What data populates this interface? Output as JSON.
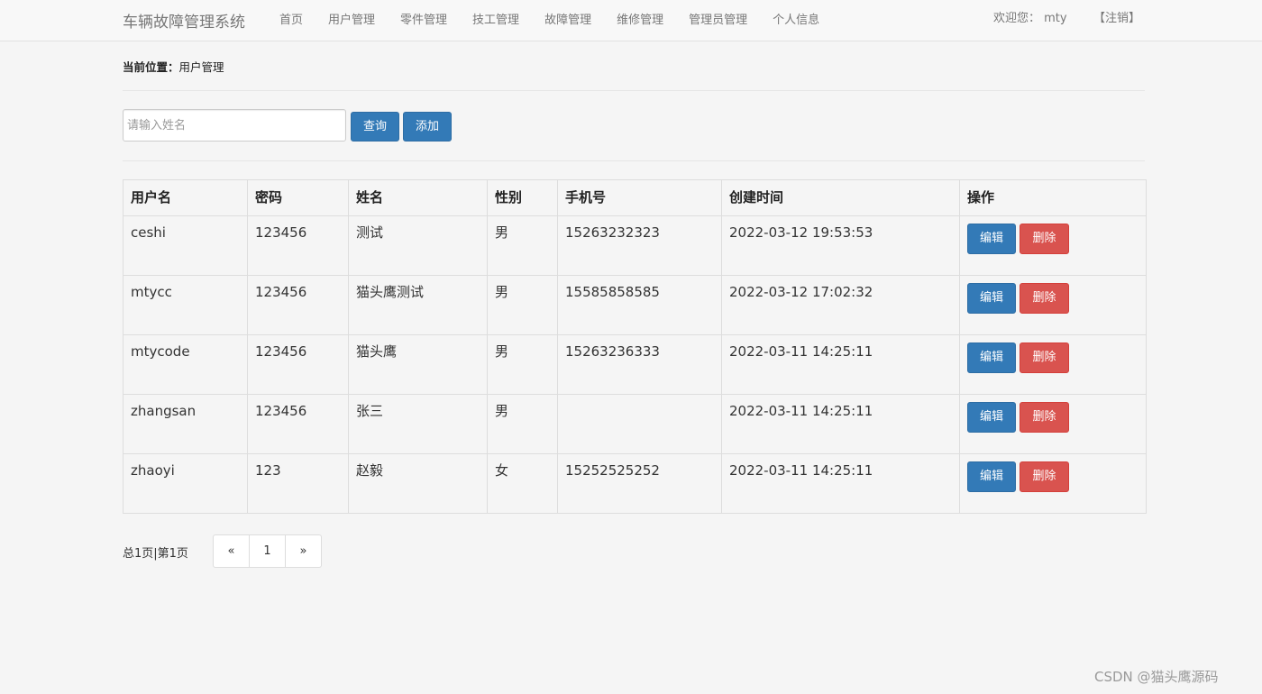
{
  "app": {
    "brand": "车辆故障管理系统"
  },
  "nav": {
    "items": [
      "首页",
      "用户管理",
      "零件管理",
      "技工管理",
      "故障管理",
      "维修管理",
      "管理员管理",
      "个人信息"
    ],
    "welcome": "欢迎您： mty",
    "logout": "【注销】"
  },
  "breadcrumb": {
    "label": "当前位置：",
    "current": "用户管理"
  },
  "search": {
    "placeholder": "请输入姓名",
    "value": "",
    "query_label": "查询",
    "add_label": "添加"
  },
  "table": {
    "headers": [
      "用户名",
      "密码",
      "姓名",
      "性别",
      "手机号",
      "创建时间",
      "操作"
    ],
    "rows": [
      [
        "ceshi",
        "123456",
        "测试",
        "男",
        "15263232323",
        "2022-03-12 19:53:53"
      ],
      [
        "mtycc",
        "123456",
        "猫头鹰测试",
        "男",
        "15585858585",
        "2022-03-12 17:02:32"
      ],
      [
        "mtycode",
        "123456",
        "猫头鹰",
        "男",
        "15263236333",
        "2022-03-11 14:25:11"
      ],
      [
        "zhangsan",
        "123456",
        "张三",
        "男",
        "",
        "2022-03-11 14:25:11"
      ],
      [
        "zhaoyi",
        "123",
        "赵毅",
        "女",
        "15252525252",
        "2022-03-11 14:25:11"
      ]
    ],
    "edit_label": "编辑",
    "delete_label": "删除"
  },
  "pagination": {
    "info": "总1页|第1页",
    "prev": "«",
    "current": "1",
    "next": "»"
  },
  "watermark": "CSDN @猫头鹰源码",
  "colors": {
    "primary": "#337ab7",
    "danger": "#d9534f",
    "background": "#f5f5f5"
  }
}
